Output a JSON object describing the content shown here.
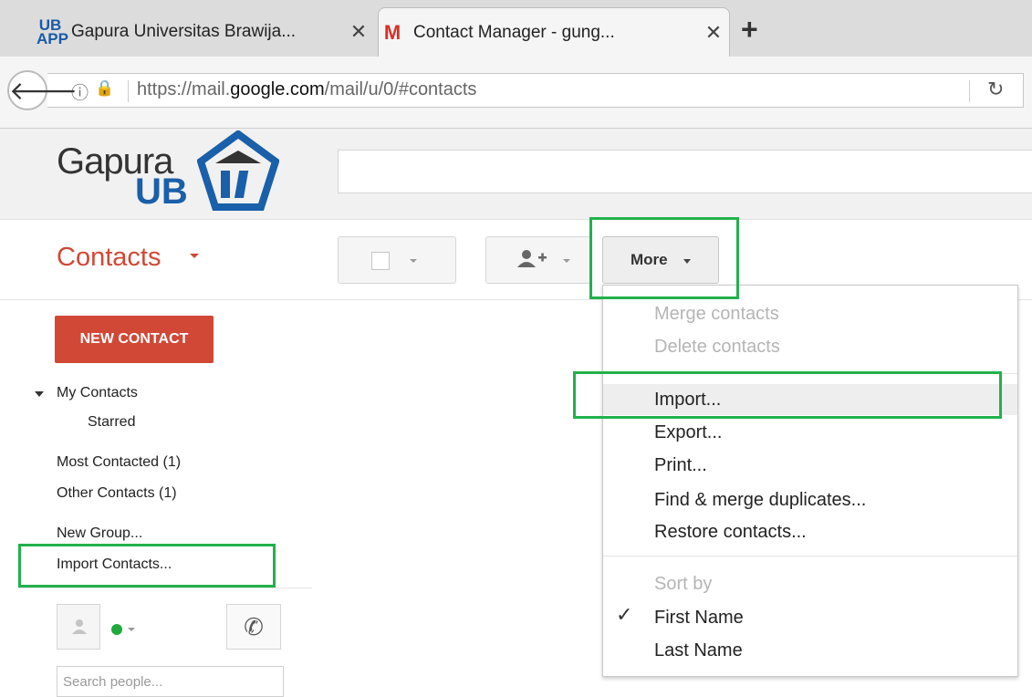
{
  "browser": {
    "tabs": [
      {
        "favicon": "UB\nAPP",
        "title": "Gapura Universitas Brawija...",
        "active": false
      },
      {
        "favicon": "M",
        "title": "Contact Manager - gung...",
        "active": true
      }
    ],
    "new_tab": "+",
    "url_prefix": "https://mail.",
    "url_domain": "google.com",
    "url_suffix": "/mail/u/0/#contacts"
  },
  "logo": {
    "line1": "Gapura",
    "line2": "UB"
  },
  "app_title": "Contacts",
  "toolbar": {
    "more_label": "More"
  },
  "sidebar": {
    "new_contact": "NEW CONTACT",
    "my_contacts": "My Contacts",
    "starred": "Starred",
    "most_contacted": "Most Contacted (1)",
    "other_contacts": "Other Contacts (1)",
    "new_group": "New Group...",
    "import_contacts": "Import Contacts...",
    "search_placeholder": "Search people..."
  },
  "more_menu": {
    "merge": "Merge contacts",
    "delete": "Delete contacts",
    "import": "Import...",
    "export": "Export...",
    "print": "Print...",
    "find_merge": "Find & merge duplicates...",
    "restore": "Restore contacts...",
    "sort_by": "Sort by",
    "first_name": "First Name",
    "last_name": "Last Name"
  },
  "colors": {
    "brand_red": "#d14836",
    "highlight_green": "#22b14c",
    "logo_blue": "#1a5fa9"
  }
}
